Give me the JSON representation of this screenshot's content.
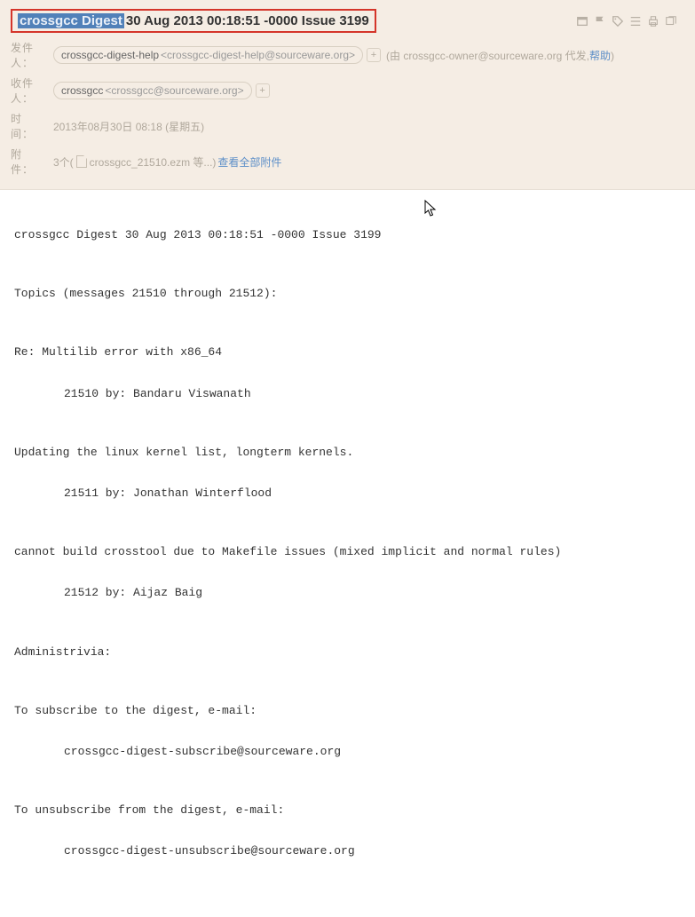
{
  "subject": {
    "highlighted": "crossgcc Digest",
    "rest": "30 Aug 2013 00:18:51 -0000 Issue 3199"
  },
  "labels": {
    "from": "发件人：",
    "to": "收件人：",
    "time": "时　间：",
    "attach": "附　件："
  },
  "from": {
    "name": "crossgcc-digest-help",
    "email": "<crossgcc-digest-help@sourceware.org>",
    "suffix_prefix": "(由 ",
    "suffix_email": "crossgcc-owner@sourceware.org",
    "suffix_mid": " 代发,",
    "help": "帮助",
    "suffix_end": ")"
  },
  "to": {
    "name": "crossgcc",
    "email": "<crossgcc@sourceware.org>"
  },
  "time": "2013年08月30日 08:18 (星期五)",
  "attach": {
    "count": "3个(",
    "filename": " crossgcc_21510.ezm 等...) ",
    "view_all": "查看全部附件"
  },
  "body": {
    "l1": "crossgcc Digest 30 Aug 2013 00:18:51 -0000 Issue 3199",
    "l2": "Topics (messages 21510 through 21512):",
    "l3": "Re: Multilib error with x86_64",
    "l3i": "21510 by: Bandaru Viswanath",
    "l4": "Updating the linux kernel list, longterm kernels.",
    "l4i": "21511 by: Jonathan Winterflood",
    "l5": "cannot build crosstool due to Makefile issues (mixed implicit and normal rules)",
    "l5i": "21512 by: Aijaz Baig",
    "l6": "Administrivia:",
    "l7": "To subscribe to the digest, e-mail:",
    "l7i": "crossgcc-digest-subscribe@sourceware.org",
    "l8": "To unsubscribe from the digest, e-mail:",
    "l8i": "crossgcc-digest-unsubscribe@sourceware.org"
  },
  "icons": {
    "window": "⊡",
    "flag": "⚑",
    "tag": "⏷",
    "reply": "↩",
    "print": "⎙",
    "more": "⎘"
  }
}
